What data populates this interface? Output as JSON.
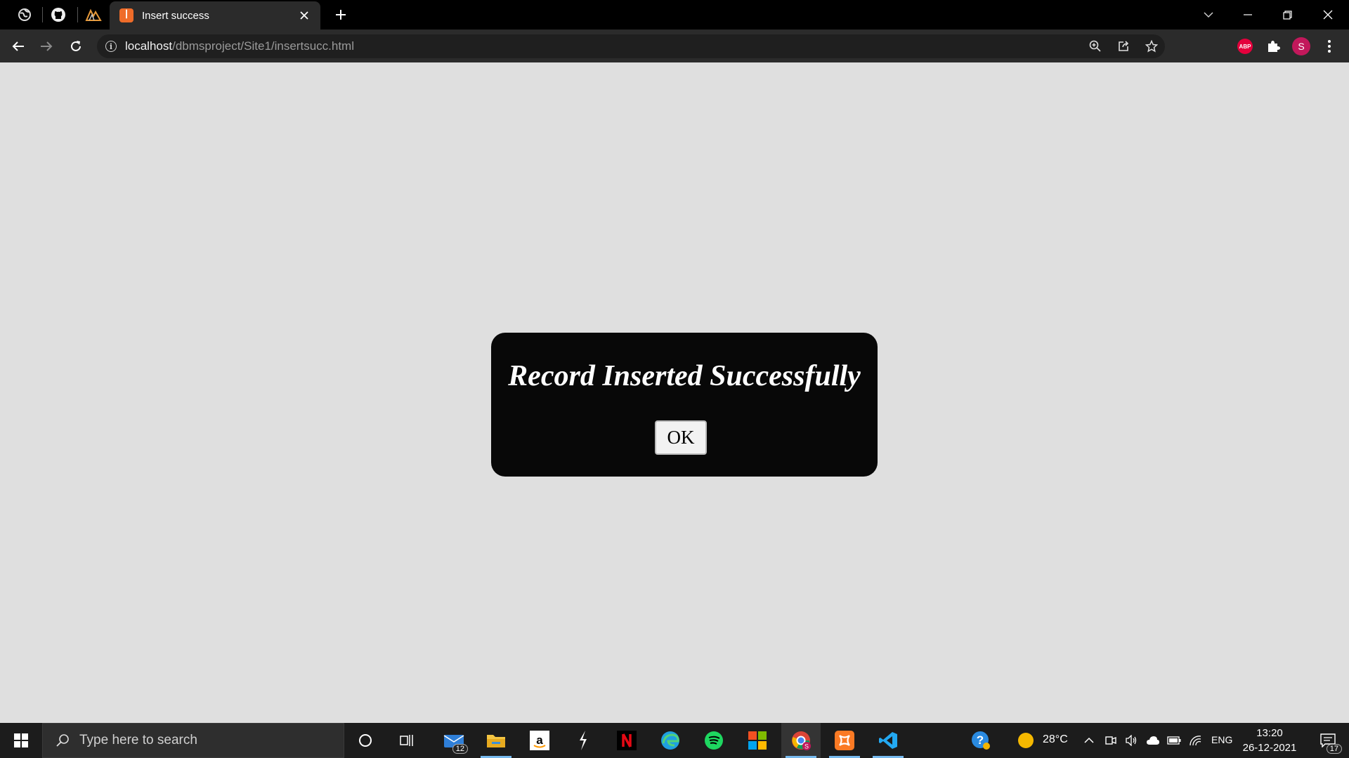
{
  "browser": {
    "tab": {
      "title": "Insert success",
      "favicon_text": "ꟾ"
    },
    "address": {
      "host": "localhost",
      "path": "/dbmsproject/Site1/insertsucc.html"
    },
    "profile_initial": "S",
    "abp_label": "ABP"
  },
  "page": {
    "dialog": {
      "message": "Record Inserted Successfully",
      "ok_label": "OK"
    }
  },
  "taskbar": {
    "search_placeholder": "Type here to search",
    "mail_badge": "12",
    "weather": "28°C",
    "language": "ENG",
    "time": "13:20",
    "date": "26-12-2021",
    "notification_count": "17"
  }
}
